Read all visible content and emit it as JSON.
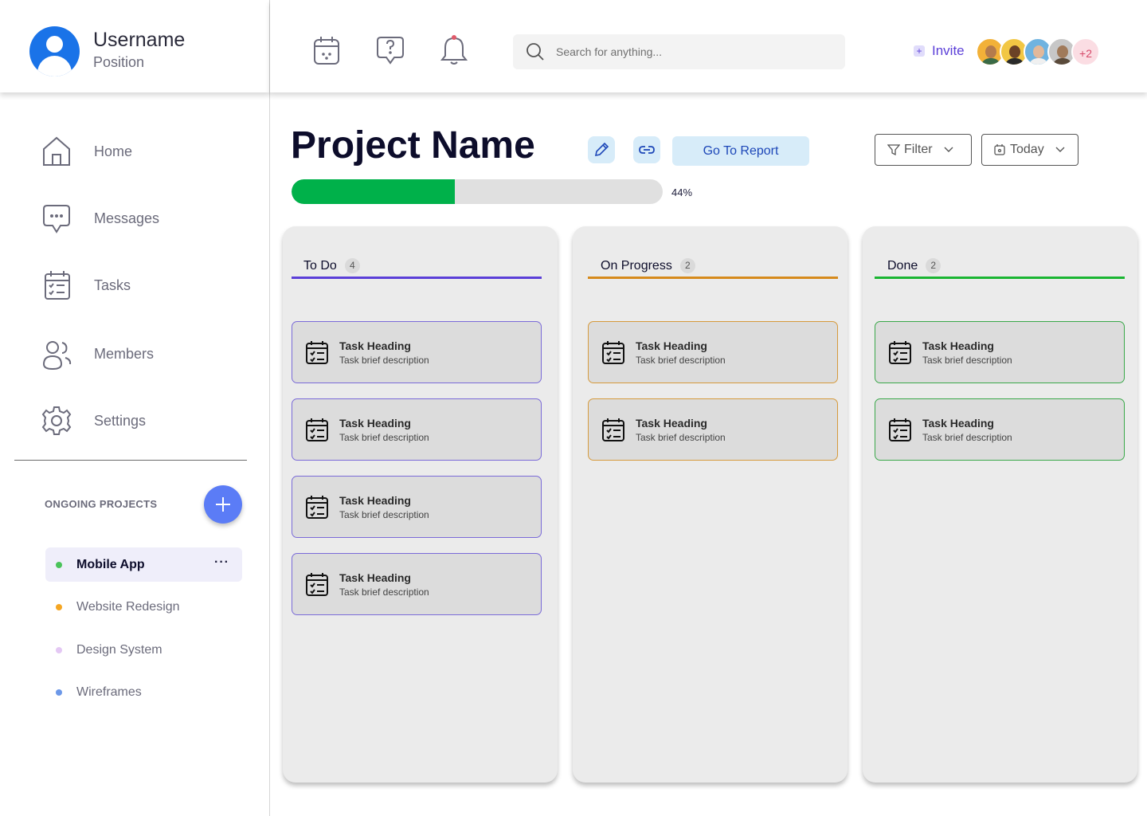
{
  "profile": {
    "username": "Username",
    "position": "Position"
  },
  "nav": [
    {
      "label": "Home",
      "icon": "home-icon"
    },
    {
      "label": "Messages",
      "icon": "message-icon"
    },
    {
      "label": "Tasks",
      "icon": "tasks-icon"
    },
    {
      "label": "Members",
      "icon": "members-icon"
    },
    {
      "label": "Settings",
      "icon": "gear-icon"
    }
  ],
  "ongoing": {
    "title": "ONGOING PROJECTS",
    "projects": [
      {
        "name": "Mobile App",
        "color": "#4ac35a",
        "active": true,
        "more": "···"
      },
      {
        "name": "Website Redesign",
        "color": "#f5a623"
      },
      {
        "name": "Design System",
        "color": "#e4c8f4"
      },
      {
        "name": "Wireframes",
        "color": "#6c98e8"
      }
    ]
  },
  "topbar": {
    "search_placeholder": "Search for anything...",
    "invite_label": "Invite",
    "invite_plus": "+",
    "extra_members": "+2"
  },
  "project": {
    "title": "Project Name",
    "report_label": "Go To Report",
    "filter_label": "Filter",
    "date_label": "Today",
    "progress": 0.44,
    "progress_label": "44%"
  },
  "columns": [
    {
      "title": "To Do",
      "count": "4",
      "color": "#5b3fd8",
      "tasks": [
        {
          "heading": "Task Heading",
          "desc": "Task brief description"
        },
        {
          "heading": "Task Heading",
          "desc": "Task brief description"
        },
        {
          "heading": "Task Heading",
          "desc": "Task brief description"
        },
        {
          "heading": "Task Heading",
          "desc": "Task brief description"
        }
      ]
    },
    {
      "title": "On Progress",
      "count": "2",
      "color": "#d68a1c",
      "tasks": [
        {
          "heading": "Task Heading",
          "desc": "Task brief description"
        },
        {
          "heading": "Task Heading",
          "desc": "Task brief description"
        }
      ]
    },
    {
      "title": "Done",
      "count": "2",
      "color": "#1ab532",
      "tasks": [
        {
          "heading": "Task Heading",
          "desc": "Task brief description"
        },
        {
          "heading": "Task Heading",
          "desc": "Task brief description"
        }
      ]
    }
  ],
  "colors": {
    "accent": "#5b7cf6",
    "progress": "#00b14a",
    "report_bg": "#d7ecf9"
  }
}
